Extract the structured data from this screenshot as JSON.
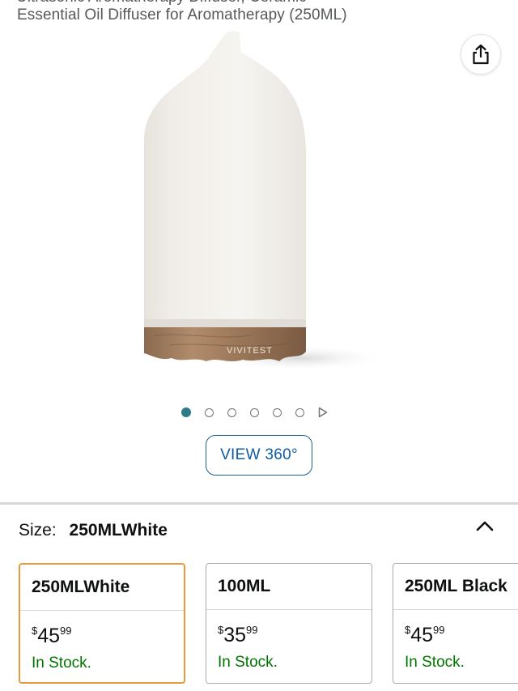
{
  "product": {
    "title_partial_above": "Ultrasonic Aromatherapy Diffuser, Ceramic",
    "title": "Essential Oil Diffuser for Aromatherapy (250ML)",
    "image_brand_text": "VIVITEST"
  },
  "share": {
    "icon": "share-icon"
  },
  "carousel": {
    "dot_count": 6,
    "active_index": 0,
    "has_video": true,
    "video_icon": "play-icon"
  },
  "view360": {
    "label": "VIEW 360°"
  },
  "size": {
    "label": "Size:",
    "selected": "250MLWhite",
    "toggle_icon": "chevron-up-icon"
  },
  "variants": [
    {
      "name": "250MLWhite",
      "currency": "$",
      "whole": "45",
      "fraction": "99",
      "stock": "In Stock.",
      "selected": true
    },
    {
      "name": "100ML",
      "currency": "$",
      "whole": "35",
      "fraction": "99",
      "stock": "In Stock.",
      "selected": false
    },
    {
      "name": "250ML Black",
      "currency": "$",
      "whole": "45",
      "fraction": "99",
      "stock": "In Stock.",
      "selected": false
    }
  ],
  "colors": {
    "accent_dot": "#2e7c87",
    "link_blue": "#0f5ba4",
    "selected_border": "#e89a3c",
    "in_stock": "#007600"
  }
}
